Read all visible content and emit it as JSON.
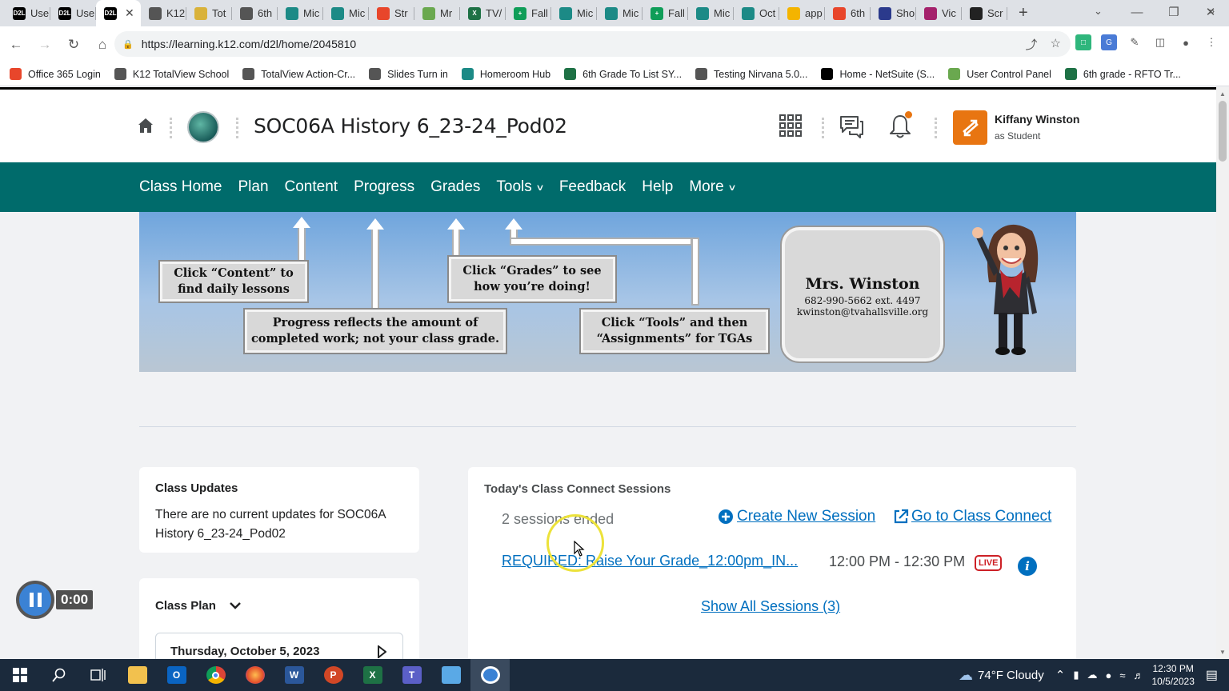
{
  "browser": {
    "tabs": [
      {
        "label": "Use",
        "icon": "D2L",
        "color": "#000"
      },
      {
        "label": "Use",
        "icon": "D2L",
        "color": "#000"
      },
      {
        "label": "",
        "icon": "D2L",
        "color": "#000",
        "active": true
      },
      {
        "label": "K12",
        "icon": "",
        "color": "#555"
      },
      {
        "label": "Tot",
        "icon": "",
        "color": "#d9b23a"
      },
      {
        "label": "6th",
        "icon": "",
        "color": "#555"
      },
      {
        "label": "Mic",
        "icon": "",
        "color": "#1c8a86"
      },
      {
        "label": "Mic",
        "icon": "",
        "color": "#1c8a86"
      },
      {
        "label": "Str",
        "icon": "",
        "color": "#e8462b"
      },
      {
        "label": "Mr",
        "icon": "",
        "color": "#6aa84f"
      },
      {
        "label": "TV/",
        "icon": "X",
        "color": "#1e7145"
      },
      {
        "label": "Fall",
        "icon": "+",
        "color": "#0f9d58"
      },
      {
        "label": "Mic",
        "icon": "",
        "color": "#1c8a86"
      },
      {
        "label": "Mic",
        "icon": "",
        "color": "#1c8a86"
      },
      {
        "label": "Fall",
        "icon": "+",
        "color": "#0f9d58"
      },
      {
        "label": "Mic",
        "icon": "",
        "color": "#1c8a86"
      },
      {
        "label": "Oct",
        "icon": "",
        "color": "#1c8a86"
      },
      {
        "label": "app",
        "icon": "",
        "color": "#f4b400"
      },
      {
        "label": "6th",
        "icon": "",
        "color": "#e8462b"
      },
      {
        "label": "Sho",
        "icon": "",
        "color": "#2b3a8c"
      },
      {
        "label": "Vic",
        "icon": "",
        "color": "#a4216b"
      },
      {
        "label": "Scr",
        "icon": "",
        "color": "#222"
      }
    ],
    "url": "https://learning.k12.com/d2l/home/2045810",
    "bookmarks": [
      {
        "label": "Office 365 Login",
        "color": "#e8462b"
      },
      {
        "label": "K12 TotalView School",
        "color": "#555"
      },
      {
        "label": "TotalView Action-Cr...",
        "color": "#555"
      },
      {
        "label": "Slides Turn in",
        "color": "#555"
      },
      {
        "label": "Homeroom Hub",
        "color": "#1c8a86"
      },
      {
        "label": "6th Grade To List SY...",
        "color": "#1e7145"
      },
      {
        "label": "Testing Nirvana 5.0...",
        "color": "#555"
      },
      {
        "label": "Home - NetSuite (S...",
        "color": "#000"
      },
      {
        "label": "User Control Panel",
        "color": "#6aa84f"
      },
      {
        "label": "6th grade - RFTO Tr...",
        "color": "#1e7145"
      }
    ]
  },
  "header": {
    "course_title": "SOC06A History 6_23-24_Pod02",
    "user_name": "Kiffany Winston",
    "user_role": "as Student"
  },
  "nav": {
    "items": [
      "Class Home",
      "Plan",
      "Content",
      "Progress",
      "Grades",
      "Tools",
      "Feedback",
      "Help",
      "More"
    ]
  },
  "banner": {
    "box_content": "Click “Content” to find daily lessons",
    "box_progress": "Progress reflects the amount of completed work; not your class grade.",
    "box_grades": "Click “Grades” to see how you’re doing!",
    "box_tools": "Click “Tools” and then “Assignments” for TGAs",
    "teacher_name": "Mrs. Winston",
    "teacher_phone": "682-990-5662 ext. 4497",
    "teacher_email": "kwinston@tvahallsville.org"
  },
  "class_updates": {
    "title": "Class Updates",
    "text": "There are no current updates for SOC06A History 6_23-24_Pod02"
  },
  "class_plan": {
    "title": "Class Plan",
    "date": "Thursday, October 5, 2023"
  },
  "sessions": {
    "title": "Today's Class Connect Sessions",
    "ended": "2 sessions ended",
    "create": "Create New Session",
    "go": "Go to Class Connect",
    "session_name": "REQUIRED: Raise Your Grade_12:00pm_IN...",
    "session_time": "12:00 PM - 12:30 PM",
    "live": "LIVE",
    "show_all": "Show All Sessions (3)"
  },
  "recorder": {
    "time": "0:00"
  },
  "taskbar": {
    "weather": "74°F  Cloudy",
    "time": "12:30 PM",
    "date": "10/5/2023"
  }
}
